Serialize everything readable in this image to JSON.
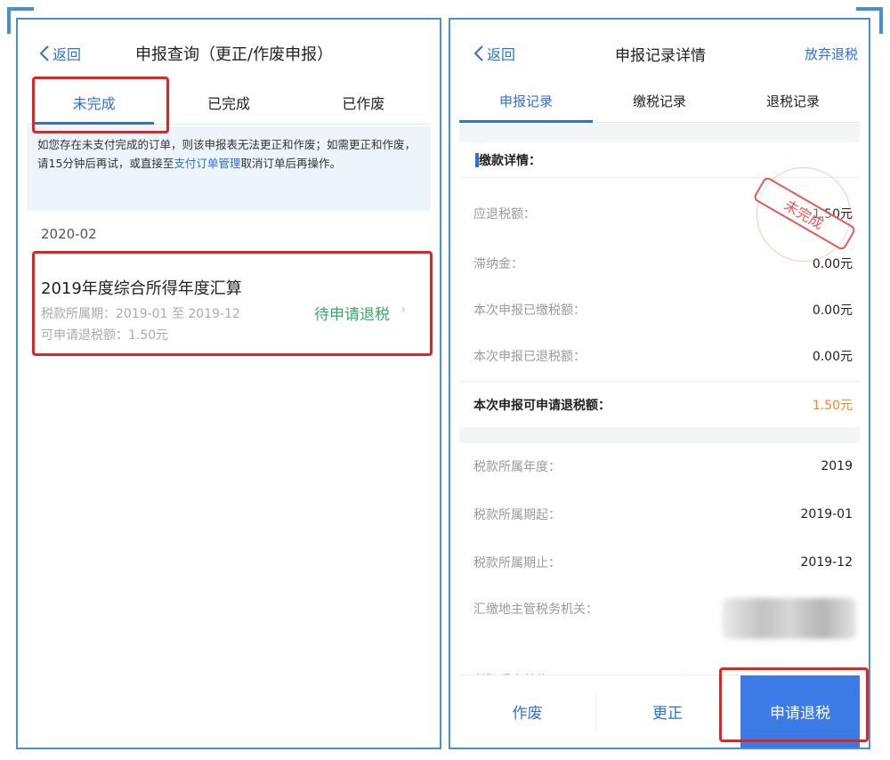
{
  "left": {
    "back_label": "返回",
    "title": "申报查询（更正/作废申报）",
    "tabs": [
      {
        "label": "未完成",
        "active": true
      },
      {
        "label": "已完成",
        "active": false
      },
      {
        "label": "已作废",
        "active": false
      }
    ],
    "notice": {
      "text_before": "如您存在未支付完成的订单，则该申报表无法更正和作废；如需更正和作废，请15分钟后再试，或直接至",
      "link": "支付订单管理",
      "text_after": "取消订单后再操作。"
    },
    "date": "2020-02",
    "record": {
      "title": "2019年度综合所得年度汇算",
      "period": "税款所属期：2019-01 至 2019-12",
      "amount": "可申请退税额：1.50元",
      "status": "待申请退税",
      "arrow": "›"
    }
  },
  "right": {
    "back_label": "返回",
    "title": "申报记录详情",
    "abandon_label": "放弃退税",
    "tabs": [
      {
        "label": "申报记录",
        "active": true
      },
      {
        "label": "缴税记录",
        "active": false
      },
      {
        "label": "退税记录",
        "active": false
      }
    ],
    "section_title": "缴款详情：",
    "stamp_text": "未完成",
    "rows": [
      {
        "label": "应退税额：",
        "value": "1.50元"
      },
      {
        "label": "滞纳金：",
        "value": "0.00元"
      },
      {
        "label": "本次申报已缴税额：",
        "value": "0.00元"
      },
      {
        "label": "本次申报已退税额：",
        "value": "0.00元"
      }
    ],
    "refundable": {
      "label": "本次申报可申请退税额：",
      "value": "1.50元"
    },
    "info_rows": [
      {
        "label": "税款所属年度：",
        "value": "2019"
      },
      {
        "label": "税款所属期起：",
        "value": "2019-01"
      },
      {
        "label": "税款所属期止：",
        "value": "2019-12"
      }
    ],
    "authority_label": "汇缴地主管税务机关：",
    "employer_label": "任职受雇单位：",
    "buttons": {
      "cancel": "作废",
      "correct": "更正",
      "refund": "申请退税"
    }
  },
  "colors": {
    "accent": "#2f6fd6",
    "status_green": "#3aa76d",
    "amount_orange": "#f08a24",
    "highlight_red": "#e02323",
    "frame_blue": "#4a90c8"
  }
}
